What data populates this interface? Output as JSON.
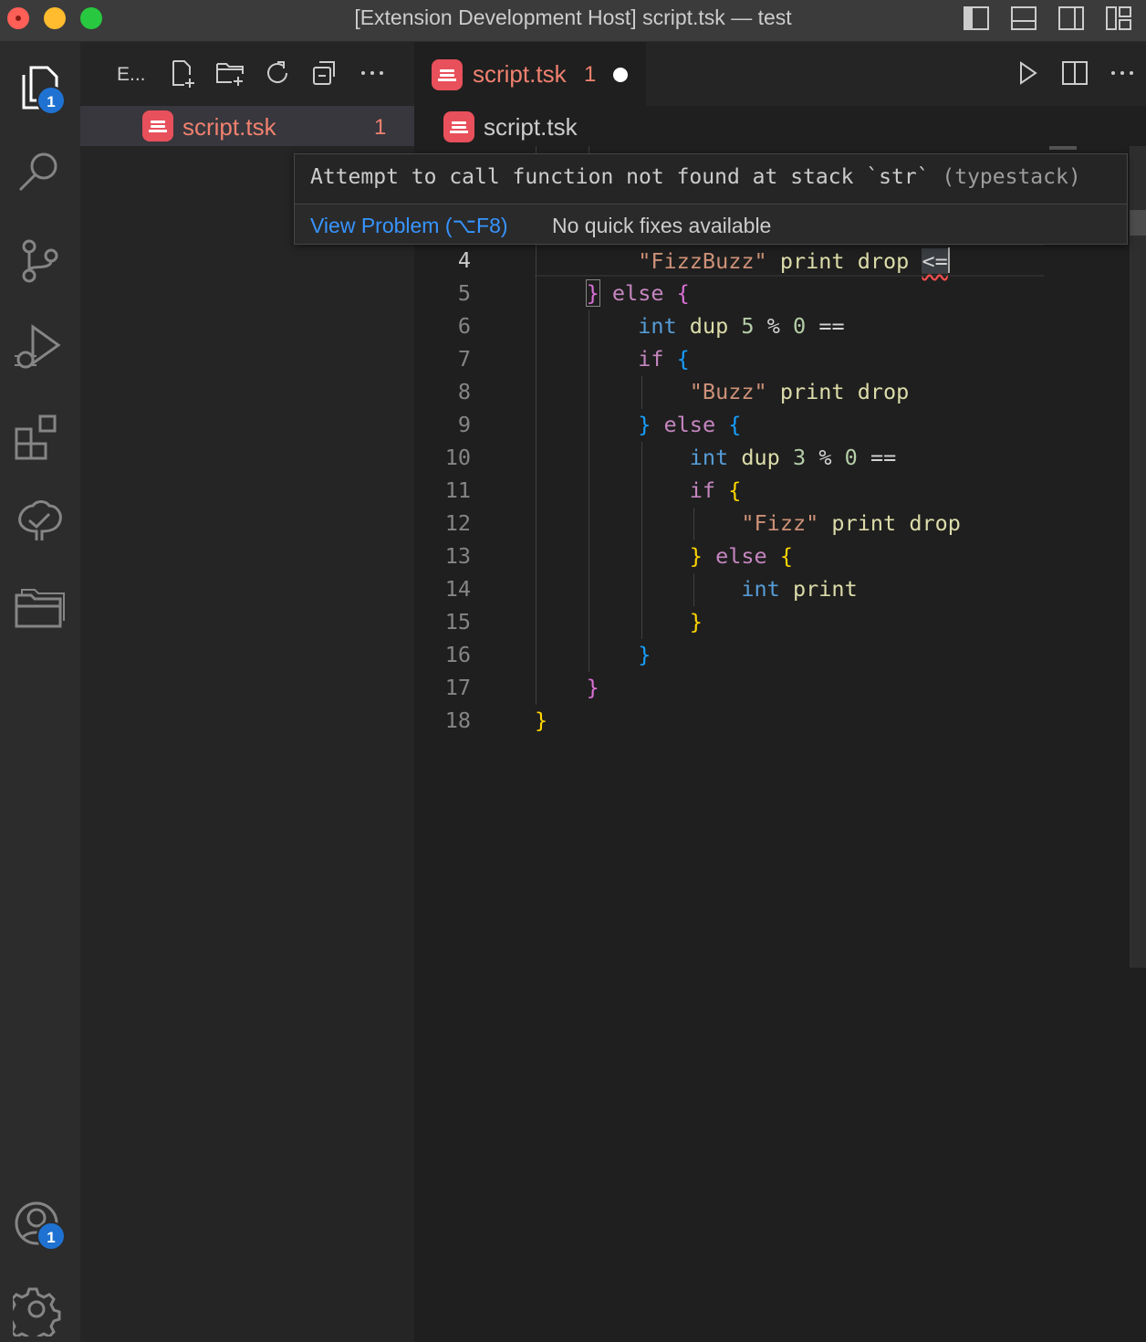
{
  "window": {
    "title": "[Extension Development Host] script.tsk — test"
  },
  "title_bar": {
    "layout_icons": [
      "toggle-primary-sidebar-icon",
      "toggle-panel-icon",
      "toggle-secondary-sidebar-icon",
      "customize-layout-icon"
    ]
  },
  "activity_bar": {
    "items": [
      {
        "name": "explorer-icon",
        "badge": "1"
      },
      {
        "name": "search-icon"
      },
      {
        "name": "source-control-icon"
      },
      {
        "name": "run-and-debug-icon"
      },
      {
        "name": "extensions-icon"
      },
      {
        "name": "testing-icon"
      },
      {
        "name": "folders-icon"
      }
    ],
    "accounts_badge": "1",
    "manage": "gear-icon"
  },
  "sidebar": {
    "title": "E...",
    "actions": [
      "new-file-icon",
      "new-folder-icon",
      "refresh-icon",
      "collapse-all-icon",
      "more-actions-icon"
    ],
    "file": {
      "name": "script.tsk",
      "problems": "1"
    }
  },
  "editor": {
    "tab": {
      "name": "script.tsk",
      "problems": "1",
      "dirty": true
    },
    "actions": [
      "run-icon",
      "split-editor-icon",
      "more-actions-icon"
    ],
    "breadcrumb": "script.tsk",
    "line_numbers": [
      "4",
      "5",
      "6",
      "7",
      "8",
      "9",
      "10",
      "11",
      "12",
      "13",
      "14",
      "15",
      "16",
      "17",
      "18"
    ],
    "code": {
      "l4": {
        "str": "\"FizzBuzz\"",
        "print": "print",
        "drop": "drop",
        "op": "<="
      },
      "l5": {
        "close": "}",
        "kw": "else",
        "open": "{"
      },
      "l6": {
        "int": "int",
        "dup": "dup",
        "num": "5",
        "mod": "%",
        "zero": "0",
        "eq": "=="
      },
      "l7": {
        "kw": "if",
        "open": "{"
      },
      "l8": {
        "str": "\"Buzz\"",
        "print": "print",
        "drop": "drop"
      },
      "l9": {
        "close": "}",
        "kw": "else",
        "open": "{"
      },
      "l10": {
        "int": "int",
        "dup": "dup",
        "num": "3",
        "mod": "%",
        "zero": "0",
        "eq": "=="
      },
      "l11": {
        "kw": "if",
        "open": "{"
      },
      "l12": {
        "str": "\"Fizz\"",
        "print": "print",
        "drop": "drop"
      },
      "l13": {
        "close": "}",
        "kw": "else",
        "open": "{"
      },
      "l14": {
        "int": "int",
        "print": "print"
      },
      "l15": {
        "close": "}"
      },
      "l16": {
        "close": "}"
      },
      "l17": {
        "close": "}"
      },
      "l18": {
        "close": "}"
      }
    }
  },
  "hover": {
    "message": "Attempt to call function not found at stack `str`",
    "source": "(typestack)",
    "view_problem": "View Problem (⌥F8)",
    "no_quick_fixes": "No quick fixes available"
  }
}
